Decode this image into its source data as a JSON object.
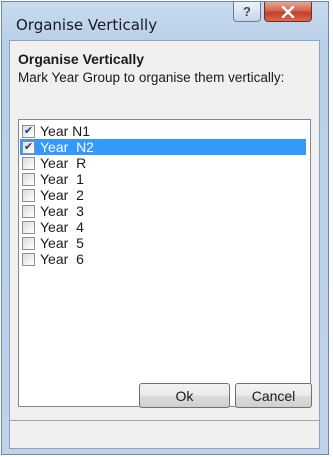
{
  "window": {
    "title": "Organise Vertically",
    "help_glyph": "?",
    "close_icon": "close-icon",
    "accent_close": "#c7432f"
  },
  "panel": {
    "heading": "Organise Vertically",
    "instruction": "Mark Year Group to organise them vertically:"
  },
  "year_groups": [
    {
      "label": "Year N1",
      "checked": true,
      "selected": false
    },
    {
      "label": "Year  N2",
      "checked": true,
      "selected": true
    },
    {
      "label": "Year  R",
      "checked": false,
      "selected": false
    },
    {
      "label": "Year  1",
      "checked": false,
      "selected": false
    },
    {
      "label": "Year  2",
      "checked": false,
      "selected": false
    },
    {
      "label": "Year  3",
      "checked": false,
      "selected": false
    },
    {
      "label": "Year  4",
      "checked": false,
      "selected": false
    },
    {
      "label": "Year  5",
      "checked": false,
      "selected": false
    },
    {
      "label": "Year  6",
      "checked": false,
      "selected": false
    }
  ],
  "buttons": {
    "ok": "Ok",
    "cancel": "Cancel"
  },
  "colors": {
    "selection": "#3399ff"
  }
}
